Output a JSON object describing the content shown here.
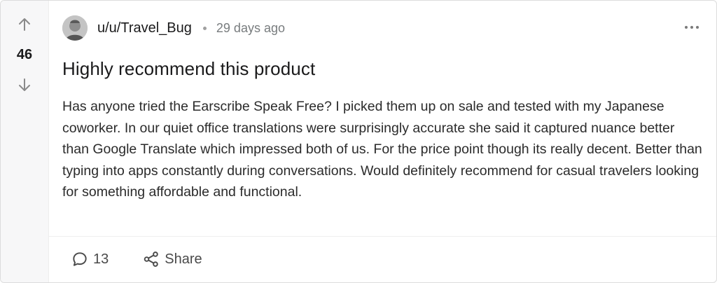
{
  "post": {
    "votes": "46",
    "author": "u/u/Travel_Bug",
    "time": "29 days ago",
    "title": "Highly recommend this product",
    "body": "Has anyone tried the Earscribe Speak Free? I picked them up on sale and tested with my Japanese coworker. In our quiet office translations were surprisingly accurate she said it captured nuance better than Google Translate which impressed both of us. For the price point though its really decent. Better than typing into apps constantly during conversations. Would definitely recommend for casual travelers looking for something affordable and functional."
  },
  "footer": {
    "comments_count": "13",
    "share_label": "Share"
  },
  "icons": {
    "upvote": "arrow-up-icon",
    "downvote": "arrow-down-icon",
    "more": "more-horizontal-icon",
    "comment": "comment-icon",
    "share": "share-icon"
  },
  "colors": {
    "vote_column_bg": "#f7f7f8",
    "text": "#1a1a1b",
    "muted": "#787c7e",
    "border": "#dcdcdc"
  }
}
